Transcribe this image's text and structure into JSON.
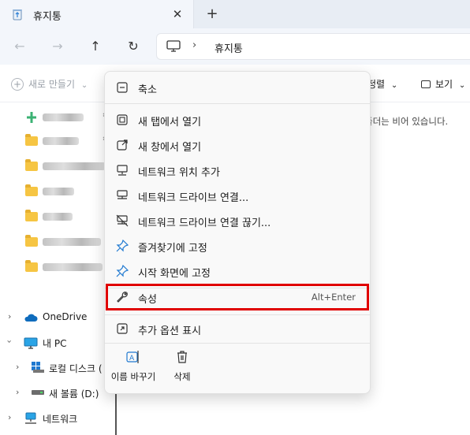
{
  "tab": {
    "title": "휴지통",
    "close": "✕",
    "new": "+"
  },
  "nav": {
    "back": "←",
    "forward": "→",
    "up": "↑",
    "refresh": "↻",
    "separator": "›",
    "location": "휴지통"
  },
  "command_bar": {
    "new": "새로 만들기",
    "new_chevron": "⌄",
    "sort": "정렬",
    "view": "보기",
    "chevron": "⌄"
  },
  "empty_message": "폴더는 비어 있습니다.",
  "tree": {
    "onedrive": "OneDrive",
    "this_pc": "내 PC",
    "local_disk": "로컬 디스크 (",
    "new_volume": "새 볼륨 (D:)",
    "network": "네트워크"
  },
  "context_menu": {
    "collapse": "축소",
    "open_new_tab": "새 탭에서 열기",
    "open_new_window": "새 창에서 열기",
    "add_network_location": "네트워크 위치 추가",
    "map_network_drive": "네트워크 드라이브 연결...",
    "disconnect_network_drive": "네트워크 드라이브 연결 끊기...",
    "pin_favorites": "즐겨찾기에 고정",
    "pin_start": "시작 화면에 고정",
    "properties": "속성",
    "properties_shortcut": "Alt+Enter",
    "show_more_options": "추가 옵션 표시",
    "rename": "이름 바꾸기",
    "delete": "삭제"
  },
  "colors": {
    "highlight": "#e00000",
    "accent": "#0067c0",
    "folder": "#f6c543"
  }
}
